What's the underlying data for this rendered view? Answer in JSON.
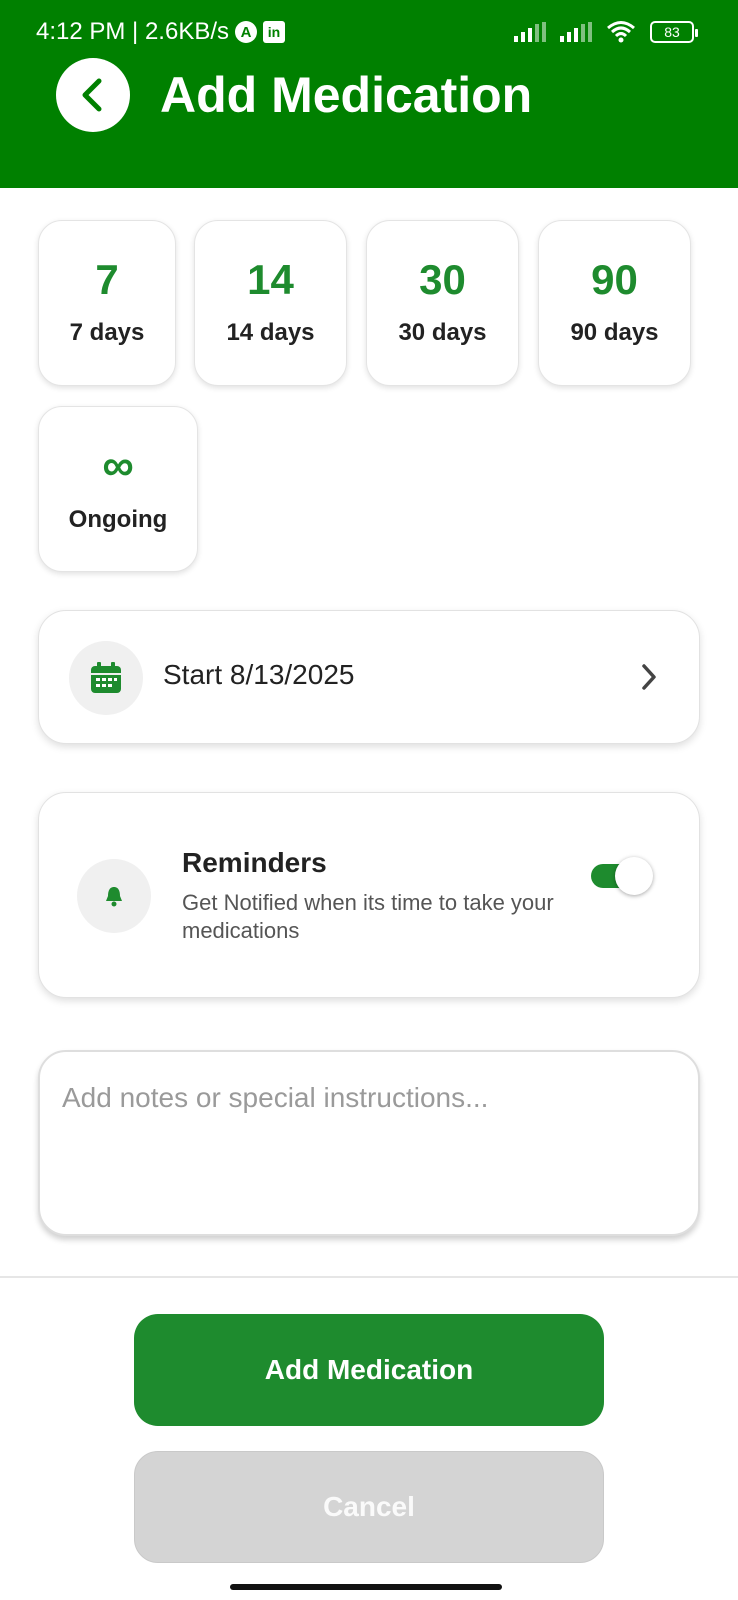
{
  "status_bar": {
    "time_speed": "4:12 PM | 2.6KB/s",
    "battery": "83"
  },
  "header": {
    "title": "Add Medication"
  },
  "durations": [
    {
      "value": "7",
      "label": "7 days"
    },
    {
      "value": "14",
      "label": "14 days"
    },
    {
      "value": "30",
      "label": "30 days"
    },
    {
      "value": "90",
      "label": "90 days"
    },
    {
      "value": "∞",
      "label": "Ongoing"
    }
  ],
  "start_date": {
    "label": "Start 8/13/2025"
  },
  "reminders": {
    "title": "Reminders",
    "description": "Get Notified when its time to take your medications",
    "enabled": true
  },
  "notes": {
    "placeholder": "Add notes or special instructions..."
  },
  "buttons": {
    "add": "Add Medication",
    "cancel": "Cancel"
  },
  "colors": {
    "header_green": "#008000",
    "accent_green": "#1e8b2e",
    "cancel_gray": "#d4d4d4"
  }
}
